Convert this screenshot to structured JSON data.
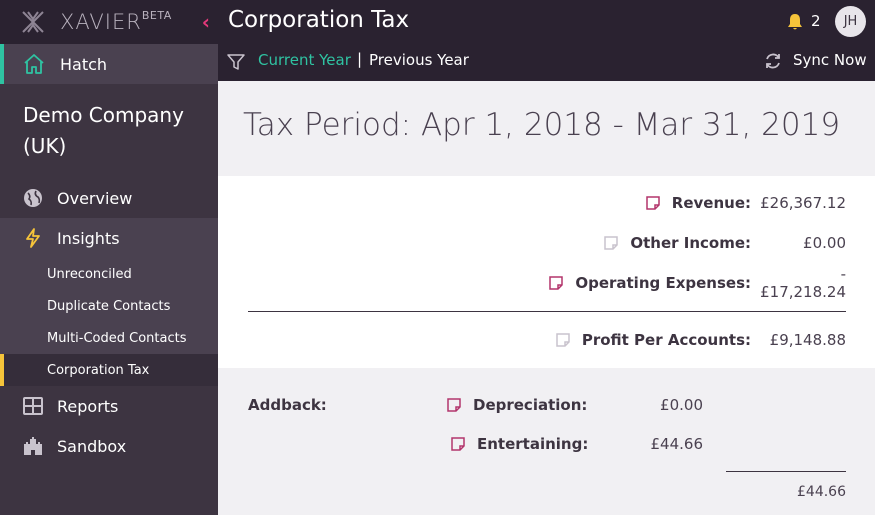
{
  "brand": {
    "name": "XAVIER",
    "beta": "BETA",
    "collapse_icon": "chevron-left-icon"
  },
  "sidebar": {
    "hatch": "Hatch",
    "company": "Demo Company (UK)",
    "items": [
      {
        "label": "Overview",
        "icon": "globe-icon"
      },
      {
        "label": "Insights",
        "icon": "lightning-icon"
      }
    ],
    "sub_items": [
      {
        "label": "Unreconciled"
      },
      {
        "label": "Duplicate Contacts"
      },
      {
        "label": "Multi-Coded Contacts"
      },
      {
        "label": "Corporation Tax",
        "active": true
      }
    ],
    "bottom_items": [
      {
        "label": "Reports",
        "icon": "grid-icon"
      },
      {
        "label": "Sandbox",
        "icon": "castle-icon"
      }
    ]
  },
  "header": {
    "title": "Corporation Tax",
    "notification_count": "2",
    "avatar_initials": "JH",
    "current_year": "Current Year",
    "separator": "|",
    "previous_year": "Previous Year",
    "sync": "Sync Now"
  },
  "period": {
    "title": "Tax Period: Apr 1, 2018 - Mar 31, 2019"
  },
  "summary": {
    "revenue": {
      "label": "Revenue:",
      "value": "£26,367.12"
    },
    "other_income": {
      "label": "Other Income:",
      "value": "£0.00"
    },
    "operating_expenses": {
      "label": "Operating Expenses:",
      "value": "- £17,218.24"
    },
    "profit": {
      "label": "Profit Per Accounts:",
      "value": "£9,148.88"
    }
  },
  "addback": {
    "heading": "Addback:",
    "depreciation": {
      "label": "Depreciation:",
      "value": "£0.00"
    },
    "entertaining": {
      "label": "Entertaining:",
      "value": "£44.66"
    },
    "total": "£44.66"
  },
  "colors": {
    "accent_green": "#2fc3a2",
    "accent_pink": "#e4397b",
    "accent_yellow": "#f6c43a",
    "sidebar_bg": "#3d3441",
    "topbar_bg": "#2a2230"
  }
}
